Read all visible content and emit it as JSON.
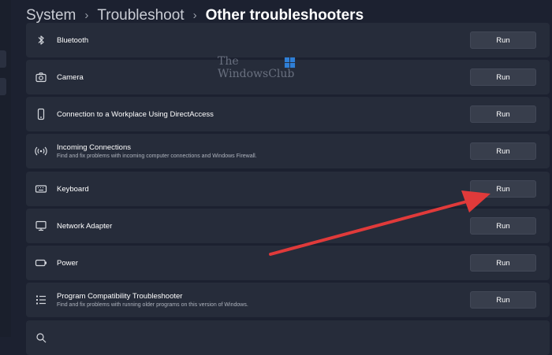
{
  "breadcrumb": {
    "items": [
      "System",
      "Troubleshoot"
    ],
    "separator": "›",
    "current": "Other troubleshooters"
  },
  "troubleshooters": [
    {
      "title": "Bluetooth",
      "description": "",
      "icon": "bluetooth-icon",
      "button": "Run"
    },
    {
      "title": "Camera",
      "description": "",
      "icon": "camera-icon",
      "button": "Run"
    },
    {
      "title": "Connection to a Workplace Using DirectAccess",
      "description": "",
      "icon": "phone-icon",
      "button": "Run"
    },
    {
      "title": "Incoming Connections",
      "description": "Find and fix problems with incoming computer connections and Windows Firewall.",
      "icon": "wireless-signal-icon",
      "button": "Run"
    },
    {
      "title": "Keyboard",
      "description": "",
      "icon": "keyboard-icon",
      "button": "Run"
    },
    {
      "title": "Network Adapter",
      "description": "",
      "icon": "monitor-icon",
      "button": "Run"
    },
    {
      "title": "Power",
      "description": "",
      "icon": "battery-icon",
      "button": "Run"
    },
    {
      "title": "Program Compatibility Troubleshooter",
      "description": "Find and fix problems with running older programs on this version of Windows.",
      "icon": "list-icon",
      "button": "Run"
    },
    {
      "title": "",
      "description": "",
      "icon": "search-icon",
      "button": ""
    }
  ],
  "watermark": {
    "line1": "The",
    "line2": "WindowsClub"
  },
  "annotation": {
    "arrow_color": "#e03a3a",
    "target": "Keyboard"
  },
  "colors": {
    "background": "#1c2130",
    "card": "#262c3a",
    "button": "#383e4c",
    "watermark_blue": "#2f7fd6"
  }
}
